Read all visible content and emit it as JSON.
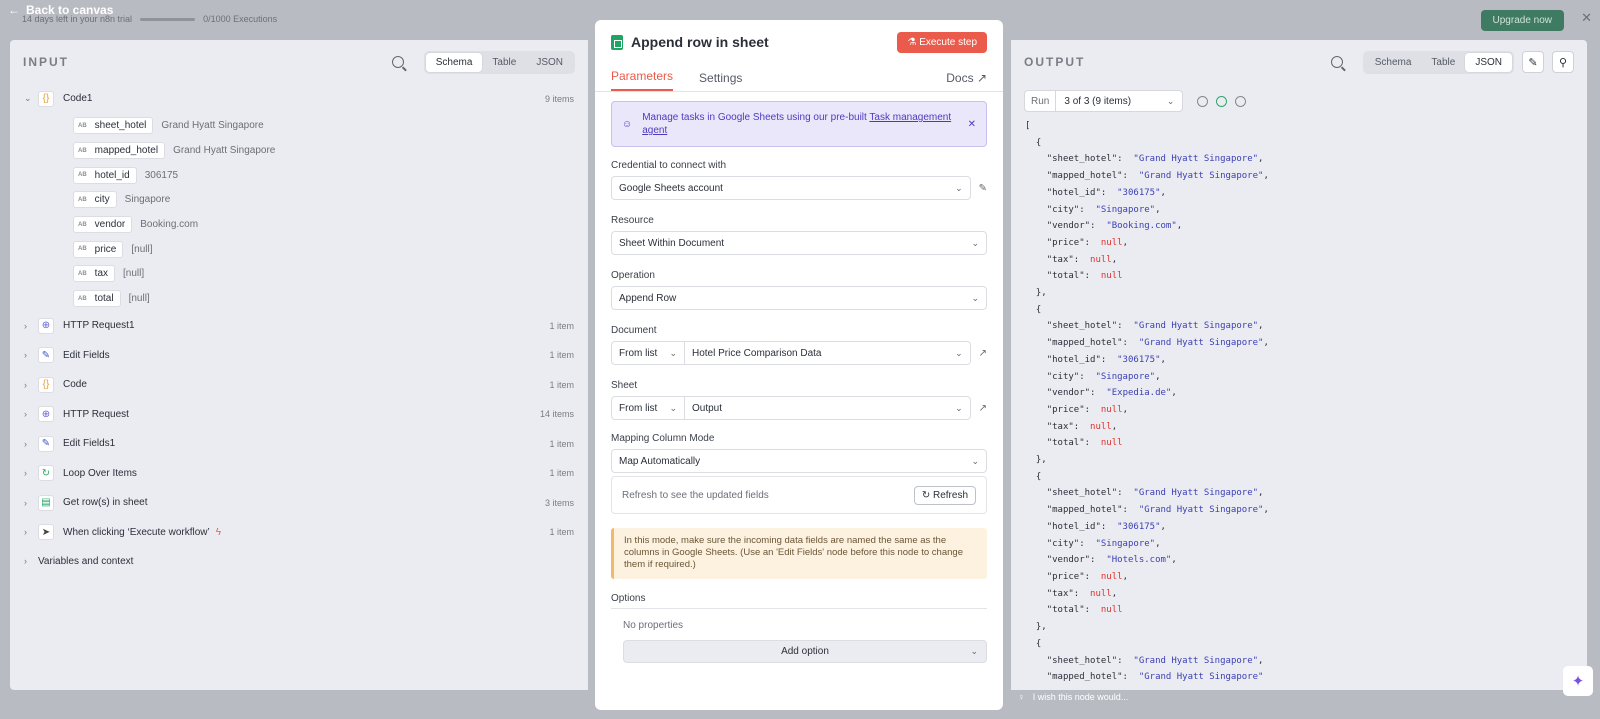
{
  "topbar": {
    "back_label": "Back to canvas",
    "trial_text": "14 days left in your n8n trial",
    "executions_text": "0/1000 Executions",
    "upgrade_label": "Upgrade now"
  },
  "input": {
    "title": "INPUT",
    "view_tabs": [
      "Schema",
      "Table",
      "JSON"
    ],
    "active_view": "Schema",
    "code_node": {
      "name": "Code1",
      "count": "9 items"
    },
    "fields": [
      {
        "key": "sheet_hotel",
        "value": "Grand Hyatt Singapore"
      },
      {
        "key": "mapped_hotel",
        "value": "Grand Hyatt Singapore"
      },
      {
        "key": "hotel_id",
        "value": "306175"
      },
      {
        "key": "city",
        "value": "Singapore"
      },
      {
        "key": "vendor",
        "value": "Booking.com"
      },
      {
        "key": "price",
        "value": "[null]"
      },
      {
        "key": "tax",
        "value": "[null]"
      },
      {
        "key": "total",
        "value": "[null]"
      }
    ],
    "nodes": [
      {
        "name": "HTTP Request1",
        "count": "1 item"
      },
      {
        "name": "Edit Fields",
        "count": "1 item"
      },
      {
        "name": "Code",
        "count": "1 item"
      },
      {
        "name": "HTTP Request",
        "count": "14 items"
      },
      {
        "name": "Edit Fields1",
        "count": "1 item"
      },
      {
        "name": "Loop Over Items",
        "count": "1 item"
      },
      {
        "name": "Get row(s) in sheet",
        "count": "3 items"
      },
      {
        "name": "When clicking ‘Execute workflow’",
        "count": "1 item"
      }
    ],
    "variables_label": "Variables and context"
  },
  "center": {
    "title": "Append row in sheet",
    "execute_label": "Execute step",
    "tabs": [
      "Parameters",
      "Settings"
    ],
    "docs_label": "Docs",
    "promo_text": "Manage tasks in Google Sheets using our pre-built ",
    "promo_link": "Task management agent",
    "credential_label": "Credential to connect with",
    "credential_value": "Google Sheets account",
    "resource_label": "Resource",
    "resource_value": "Sheet Within Document",
    "operation_label": "Operation",
    "operation_value": "Append Row",
    "document_label": "Document",
    "document_mode": "From list",
    "document_value": "Hotel Price Comparison Data",
    "sheet_label": "Sheet",
    "sheet_mode": "From list",
    "sheet_value": "Output",
    "mapping_label": "Mapping Column Mode",
    "mapping_value": "Map Automatically",
    "refresh_hint": "Refresh to see the updated fields",
    "refresh_label": "Refresh",
    "note_text": "In this mode, make sure the incoming data fields are named the same as the columns in Google Sheets. (Use an 'Edit Fields' node before this node to change them if required.)",
    "options_label": "Options",
    "no_props": "No properties",
    "add_option": "Add option"
  },
  "output": {
    "title": "OUTPUT",
    "view_tabs": [
      "Schema",
      "Table",
      "JSON"
    ],
    "active_view": "JSON",
    "run_label": "Run",
    "run_value": "3 of 3 (9 items)",
    "records": [
      {
        "sheet_hotel": "Grand Hyatt Singapore",
        "mapped_hotel": "Grand Hyatt Singapore",
        "hotel_id": "306175",
        "city": "Singapore",
        "vendor": "Booking.com",
        "price": null,
        "tax": null,
        "total": null
      },
      {
        "sheet_hotel": "Grand Hyatt Singapore",
        "mapped_hotel": "Grand Hyatt Singapore",
        "hotel_id": "306175",
        "city": "Singapore",
        "vendor": "Expedia.de",
        "price": null,
        "tax": null,
        "total": null
      },
      {
        "sheet_hotel": "Grand Hyatt Singapore",
        "mapped_hotel": "Grand Hyatt Singapore",
        "hotel_id": "306175",
        "city": "Singapore",
        "vendor": "Hotels.com",
        "price": null,
        "tax": null,
        "total": null
      },
      {
        "sheet_hotel": "Grand Hyatt Singapore",
        "mapped_hotel": "Grand Hyatt Singapore"
      }
    ],
    "wish_text": "I wish this node would..."
  },
  "colors": {
    "accent": "#ea5b4b",
    "promo": "#4c3bbf",
    "string": "#3b3fb5",
    "null": "#e0312c"
  }
}
